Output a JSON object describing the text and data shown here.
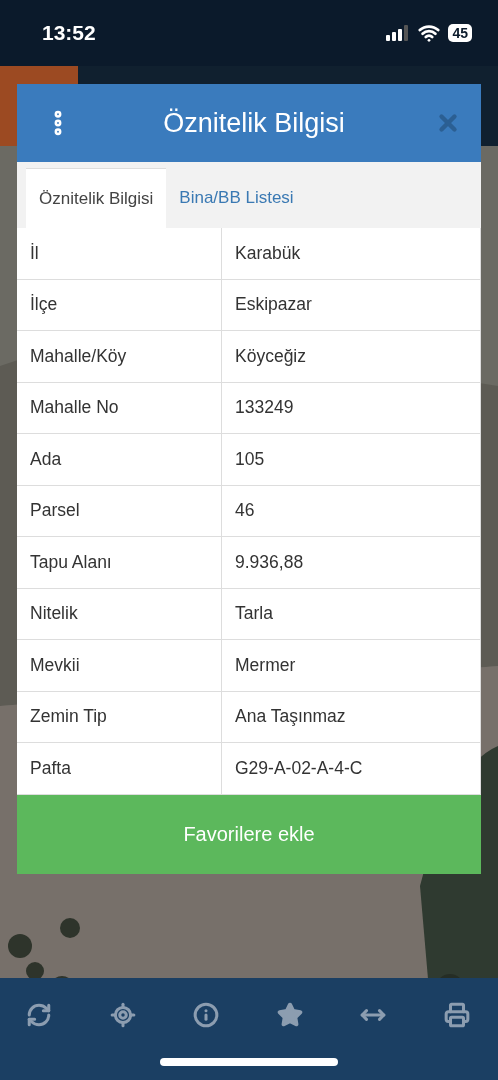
{
  "status_bar": {
    "time": "13:52",
    "battery": "45"
  },
  "dialog": {
    "title": "Öznitelik Bilgisi",
    "tabs": [
      {
        "label": "Öznitelik Bilgisi",
        "selected": true
      },
      {
        "label": "Bina/BB Listesi",
        "selected": false
      }
    ],
    "rows": [
      {
        "label": "İl",
        "value": "Karabük"
      },
      {
        "label": "İlçe",
        "value": "Eskipazar"
      },
      {
        "label": "Mahalle/Köy",
        "value": "Köyceğiz"
      },
      {
        "label": "Mahalle No",
        "value": "133249"
      },
      {
        "label": "Ada",
        "value": "105"
      },
      {
        "label": "Parsel",
        "value": "46"
      },
      {
        "label": "Tapu Alanı",
        "value": "9.936,88"
      },
      {
        "label": "Nitelik",
        "value": "Tarla"
      },
      {
        "label": "Mevkii",
        "value": "Mermer"
      },
      {
        "label": "Zemin Tip",
        "value": "Ana Taşınmaz"
      },
      {
        "label": "Pafta",
        "value": "G29-A-02-A-4-C"
      }
    ],
    "button": "Favorilere ekle"
  },
  "toolbar": [
    {
      "kind": "refresh"
    },
    {
      "kind": "locate"
    },
    {
      "kind": "info"
    },
    {
      "kind": "star"
    },
    {
      "kind": "measure"
    },
    {
      "kind": "print"
    }
  ]
}
